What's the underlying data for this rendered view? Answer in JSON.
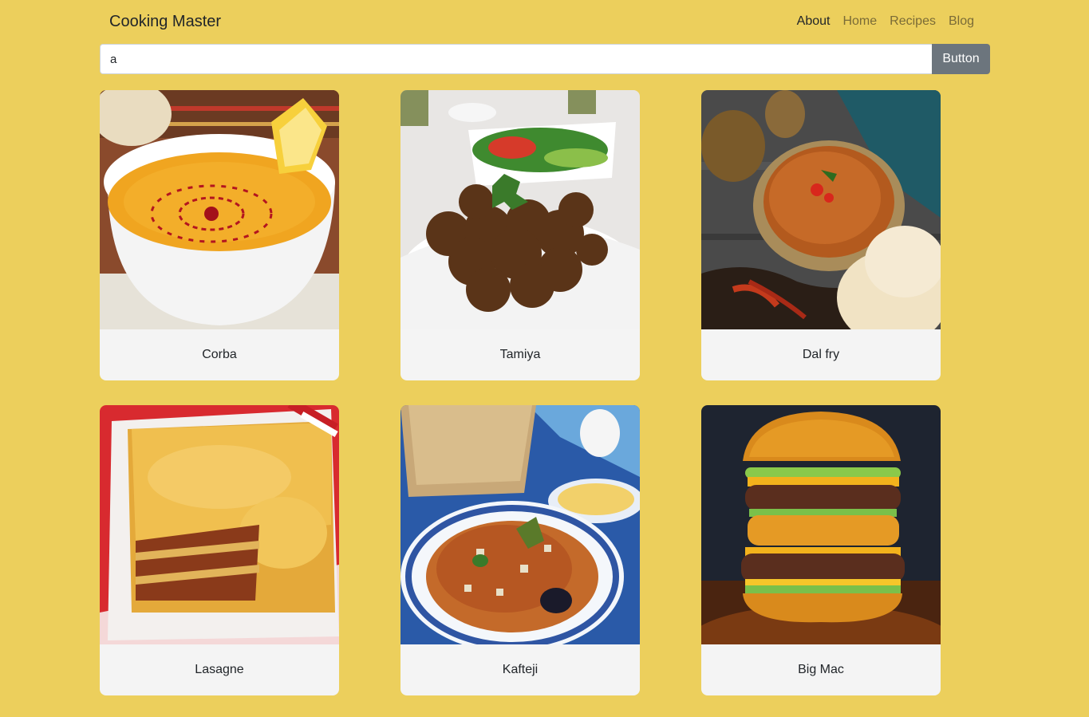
{
  "navbar": {
    "brand": "Cooking Master",
    "links": [
      {
        "label": "About",
        "active": true
      },
      {
        "label": "Home",
        "active": false
      },
      {
        "label": "Recipes",
        "active": false
      },
      {
        "label": "Blog",
        "active": false
      }
    ]
  },
  "search": {
    "value": "a",
    "button_label": "Button"
  },
  "recipes": [
    {
      "name": "Corba"
    },
    {
      "name": "Tamiya"
    },
    {
      "name": "Dal fry"
    },
    {
      "name": "Lasagne"
    },
    {
      "name": "Kafteji"
    },
    {
      "name": "Big Mac"
    }
  ],
  "colors": {
    "background": "#eccf5c",
    "button": "#6c757d",
    "card_label_bg": "#f4f4f4"
  }
}
